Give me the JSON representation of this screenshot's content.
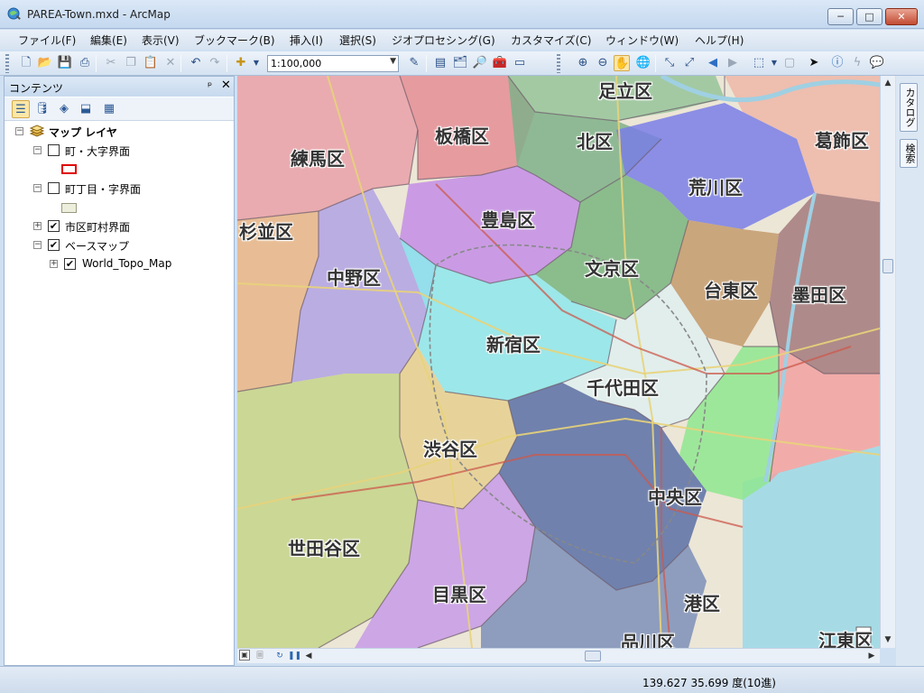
{
  "window": {
    "title": "PAREA-Town.mxd - ArcMap",
    "min_label": "─",
    "max_label": "□",
    "close_label": "✕"
  },
  "menu": [
    "ファイル(F)",
    "編集(E)",
    "表示(V)",
    "ブックマーク(B)",
    "挿入(I)",
    "選択(S)",
    "ジオプロセシング(G)",
    "カスタマイズ(C)",
    "ウィンドウ(W)",
    "ヘルプ(H)"
  ],
  "toolbar": {
    "scale_value": "1:100,000"
  },
  "toc": {
    "title": "コンテンツ",
    "pin_label": "ᵖ",
    "close_label": "✕",
    "layers": {
      "root": "マップ レイヤ",
      "l1": "町・大字界面",
      "l2": "町丁目・字界面",
      "l3": "市区町村界面",
      "l4": "ベースマップ",
      "l5": "World_Topo_Map"
    },
    "checked": {
      "l1": false,
      "l2": false,
      "l3": true,
      "l4": true,
      "l5": true
    }
  },
  "map": {
    "ward_labels": {
      "adachi": "足立区",
      "itabashi": "板橋区",
      "kita": "北区",
      "katsushika": "葛飾区",
      "nerima": "練馬区",
      "arakawa": "荒川区",
      "toshima": "豊島区",
      "suginami": "杉並区",
      "bunkyo": "文京区",
      "nakano": "中野区",
      "taito": "台東区",
      "sumida": "墨田区",
      "shinjuku": "新宿区",
      "chiyoda": "千代田区",
      "shibuya": "渋谷区",
      "chuo": "中央区",
      "setagaya": "世田谷区",
      "meguro": "目黒区",
      "minato": "港区",
      "shinagawa": "品川区",
      "koto": "江東区"
    }
  },
  "dock": {
    "catalog": "カタログ",
    "search": "検索"
  },
  "status": {
    "coords": "139.627  35.699 度(10進)"
  },
  "colors": {
    "nerima": "#e9a0a8",
    "itabashi": "#e58d95",
    "kita": "#7fb088",
    "adachi": "#96c39a",
    "arakawa": "#7a7ee6",
    "toshima": "#c48de6",
    "bunkyo": "#7ab47f",
    "taito": "#c49a6c",
    "sumida": "#a5797c",
    "nakano": "#b2a2e4",
    "shinjuku": "#8ee6ec",
    "chiyoda": "#dfeef0",
    "chuo": "#8fe68f",
    "shibuya": "#e6cf8f",
    "minato": "#5b6fa6",
    "setagaya": "#c6d48a",
    "meguro": "#c89ae8",
    "shinagawa": "#7e8fb8",
    "suginami": "#e7b58a",
    "koto": "#f2a1a1",
    "katsushika": "#efb6a8",
    "sea": "#a6dbe6"
  }
}
